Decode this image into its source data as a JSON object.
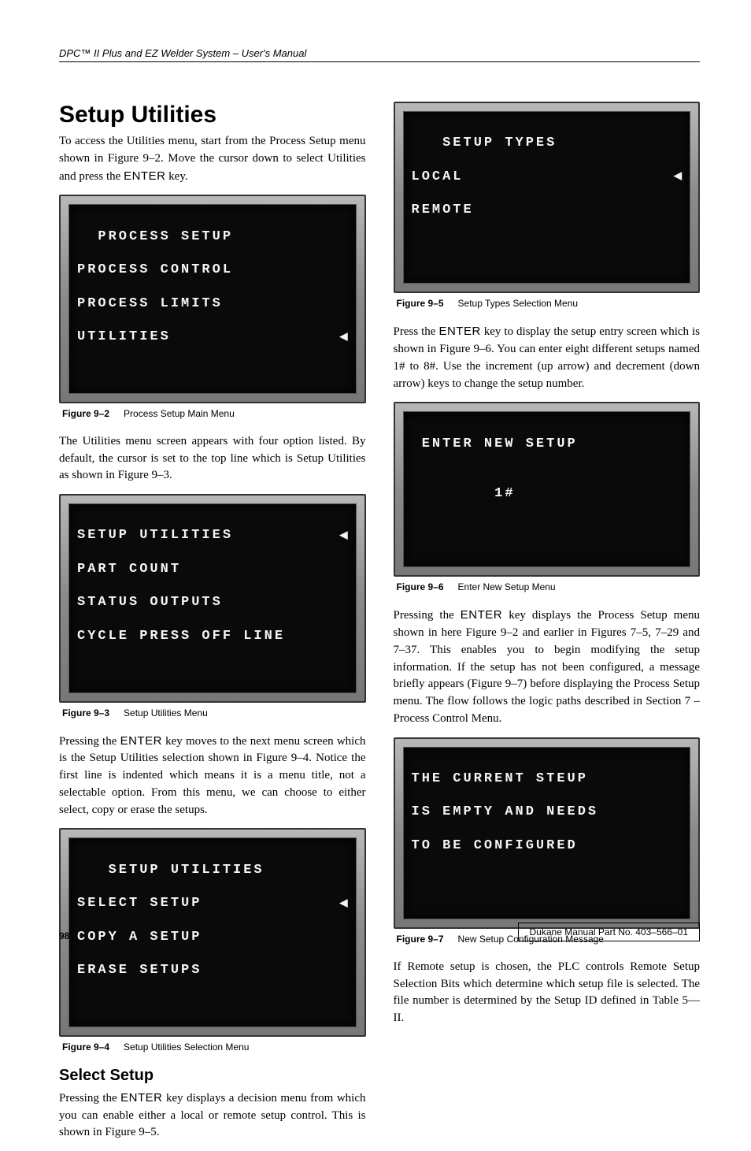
{
  "runningHead": "DPC™ II Plus and EZ Welder System – User's Manual",
  "left": {
    "title": "Setup Utilities",
    "p1a": "To access the Utilities menu, start from the Process Setup menu shown in Figure 9–2. Move the cursor down to select Utilities and press the ",
    "p1key": "ENTER",
    "p1b": " key.",
    "fig2": {
      "lines": [
        "  PROCESS SETUP",
        "PROCESS CONTROL",
        "PROCESS LIMITS",
        "UTILITIES"
      ],
      "cursorLine": 3,
      "label": "Figure 9–2",
      "caption": "Process Setup Main Menu"
    },
    "p2": "The Utilities menu screen appears with four option listed. By default, the cursor is set to the top line which is Setup Utilities as shown in Figure 9–3.",
    "fig3": {
      "lines": [
        "SETUP UTILITIES",
        "PART COUNT",
        "STATUS OUTPUTS",
        "CYCLE PRESS OFF LINE"
      ],
      "cursorLine": 0,
      "label": "Figure 9–3",
      "caption": "Setup Utilities Menu"
    },
    "p3a": "Pressing the ",
    "p3key": "ENTER",
    "p3b": " key moves to the next menu screen which is the Setup Utilities selection shown in Figure 9–4. Notice the first line is indented which means it is a menu title, not a selectable option. From this menu, we can choose to either select, copy or erase the setups.",
    "fig4": {
      "lines": [
        "   SETUP UTILITIES",
        "SELECT SETUP",
        "COPY A SETUP",
        "ERASE SETUPS"
      ],
      "cursorLine": 1,
      "label": "Figure 9–4",
      "caption": "Setup Utilities Selection Menu"
    },
    "subTitle": "Select Setup",
    "p4a": "Pressing the ",
    "p4key": "ENTER",
    "p4b": " key displays a decision menu from which you can enable either a local or remote setup control. This is shown in Figure 9–5."
  },
  "right": {
    "fig5": {
      "lines": [
        "   SETUP TYPES",
        "LOCAL",
        "REMOTE",
        ""
      ],
      "cursorLine": 1,
      "label": "Figure 9–5",
      "caption": "Setup Types Selection Menu"
    },
    "p5a": "Press the ",
    "p5key": "ENTER",
    "p5b": " key to display the setup entry screen which is shown in Figure 9–6. You can enter eight different setups named 1# to 8#. Use the increment (up arrow) and decrement (down arrow) keys to change the setup number.",
    "fig6": {
      "lines": [
        " ENTER NEW SETUP",
        "",
        "        1#",
        ""
      ],
      "cursorLine": -1,
      "label": "Figure 9–6",
      "caption": "Enter New Setup Menu"
    },
    "p6a": "Pressing the ",
    "p6key": "ENTER",
    "p6b": " key displays the Process Setup menu shown in here Figure 9–2 and earlier in Figures 7–5, 7–29 and 7–37. This enables you to begin modifying the setup information. If the setup has not been configured, a message briefly appears (Figure 9–7) before displaying the Process Setup menu. The flow follows the logic paths described in Section 7 – Process Control Menu.",
    "fig7": {
      "lines": [
        "THE CURRENT STEUP",
        "IS EMPTY AND NEEDS",
        "TO BE CONFIGURED",
        ""
      ],
      "cursorLine": -1,
      "label": "Figure 9–7",
      "caption": "New Setup Configuration Message"
    },
    "p7": "If Remote setup is chosen, the PLC controls Remote Setup Selection Bits which determine which setup file is selected. The file number is determined by the Setup ID defined in Table 5—II."
  },
  "footer": {
    "pageNum": "98",
    "partNo": "Dukane Manual Part No. 403–566–01"
  }
}
